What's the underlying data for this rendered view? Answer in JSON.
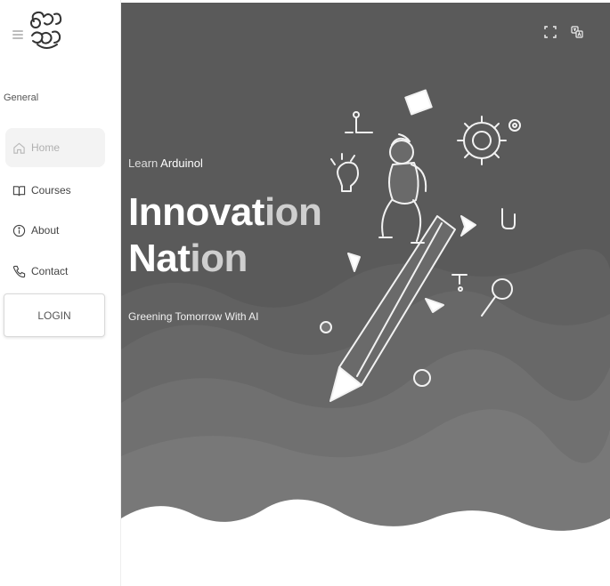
{
  "sidebar": {
    "section_title": "General",
    "items": [
      {
        "label": "Home",
        "icon": "home-icon",
        "active": true
      },
      {
        "label": "Courses",
        "icon": "book-icon",
        "active": false
      },
      {
        "label": "About",
        "icon": "info-icon",
        "active": false
      },
      {
        "label": "Contact",
        "icon": "phone-icon",
        "active": false
      }
    ],
    "login_label": "LOGIN"
  },
  "hero": {
    "eyebrow_prefix": "Learn",
    "eyebrow_highlight": "Arduinol",
    "headline_line1_bold": "Innovat",
    "headline_line1_fade": "ion",
    "headline_line2_bold": "Nat",
    "headline_line2_fade": "ion",
    "tagline": "Greening Tomorrow With AI"
  },
  "colors": {
    "hero_background": "#5a5a5a",
    "active_nav_background": "#f3f3f3"
  }
}
